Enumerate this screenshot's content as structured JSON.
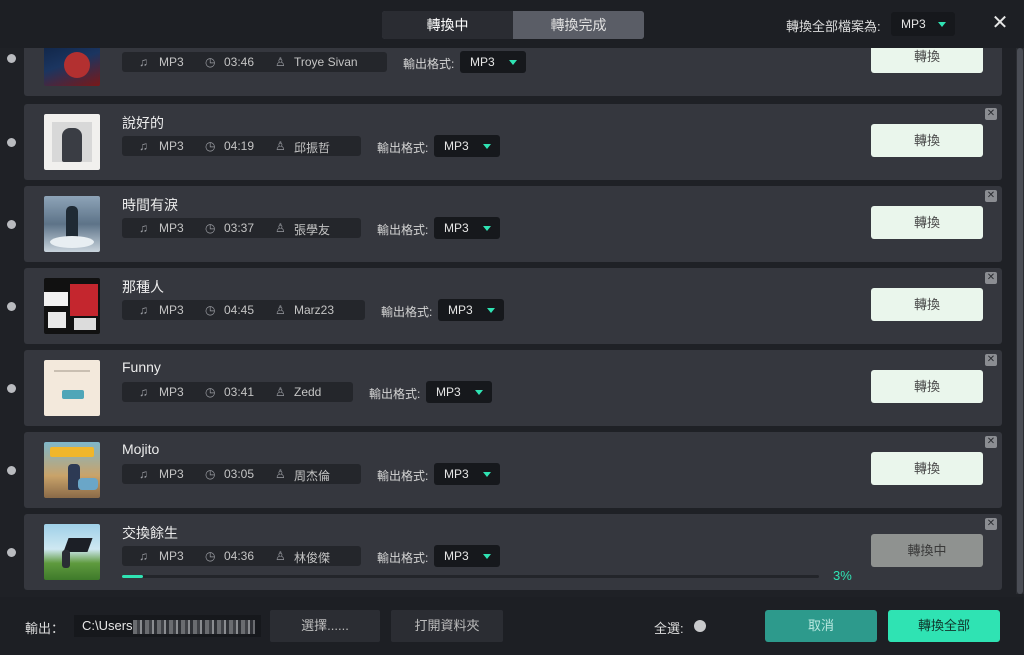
{
  "header": {
    "tabs": [
      {
        "label": "轉換中",
        "active": true
      },
      {
        "label": "轉換完成",
        "active": false
      }
    ],
    "convert_all_label": "轉換全部檔案為:",
    "convert_all_format": "MP3",
    "close_icon": "close-icon"
  },
  "list": {
    "format_label": "輸出格式:",
    "convert_label": "轉換",
    "items": [
      {
        "title": "",
        "format": "MP3",
        "duration": "03:46",
        "artist": "Troye Sivan",
        "output_format": "MP3",
        "status": "轉換"
      },
      {
        "title": "說好的",
        "format": "MP3",
        "duration": "04:19",
        "artist": "邱振哲",
        "output_format": "MP3",
        "status": "轉換"
      },
      {
        "title": "時間有淚",
        "format": "MP3",
        "duration": "03:37",
        "artist": "張學友",
        "output_format": "MP3",
        "status": "轉換"
      },
      {
        "title": "那種人",
        "format": "MP3",
        "duration": "04:45",
        "artist": "Marz23",
        "output_format": "MP3",
        "status": "轉換"
      },
      {
        "title": "Funny",
        "format": "MP3",
        "duration": "03:41",
        "artist": "Zedd",
        "output_format": "MP3",
        "status": "轉換"
      },
      {
        "title": "Mojito",
        "format": "MP3",
        "duration": "03:05",
        "artist": "周杰倫",
        "output_format": "MP3",
        "status": "轉換"
      },
      {
        "title": "交換餘生",
        "format": "MP3",
        "duration": "04:36",
        "artist": "林俊傑",
        "output_format": "MP3",
        "status": "轉換中",
        "progress": 0.03,
        "progress_text": "3%"
      }
    ]
  },
  "footer": {
    "output_label": "輸出：",
    "output_path": "C:\\Users",
    "choose_label": "選擇......",
    "open_folder_label": "打開資料夾",
    "select_all_label": "全選:",
    "cancel_label": "取消",
    "convert_all_label": "轉換全部"
  },
  "colors": {
    "accent": "#2fe3b3",
    "cancel": "#2d9a8c",
    "card": "#35373e",
    "background": "#1f2126"
  }
}
